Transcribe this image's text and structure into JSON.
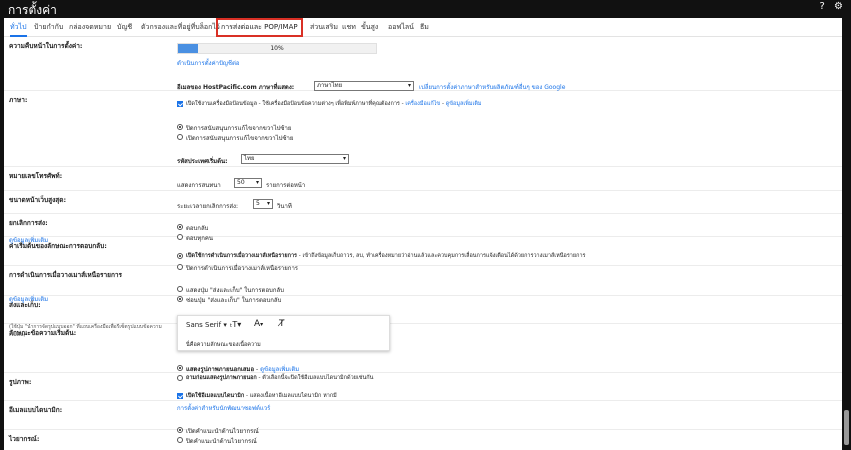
{
  "app": {
    "title": "การตั้งค่า",
    "help_icon": "help-icon",
    "settings_icon": "gear-icon"
  },
  "tabs": [
    {
      "label": "ทั่วไป",
      "active": true
    },
    {
      "label": "ป้ายกำกับ"
    },
    {
      "label": "กล่องจดหมาย"
    },
    {
      "label": "บัญชี"
    },
    {
      "label": "ตัวกรองและที่อยู่ที่บล็อกไว้"
    },
    {
      "label": "การส่งต่อและ POP/IMAP",
      "highlighted": true
    },
    {
      "label": "ส่วนเสริม"
    },
    {
      "label": "แชท"
    },
    {
      "label": "ขั้นสูง"
    },
    {
      "label": "ออฟไลน์"
    },
    {
      "label": "ธีม"
    }
  ],
  "progress": {
    "label": "ความคืบหน้าในการตั้งค่า:",
    "value_percent": 10,
    "value_text": "10%",
    "link": "ดำเนินการตั้งค่าปัญชีต่อ"
  },
  "language": {
    "label": "ภาษา:",
    "prefix": "อีเมลของ HostPacific.com ภาษาที่แสดง:",
    "selected": "ภาษาไทย",
    "change_link": "เปลี่ยนการตั้งค่าภาษาสำหรับผลิตภัณฑ์อื่นๆ ของ Google",
    "input_tools_text": "เปิดใช้งานเครื่องมือป้อนข้อมูล - ใช้เครื่องมือป้อนข้อความต่างๆ เพื่อพิมพ์ภาษาที่คุณต้องการ -",
    "input_tools_link": "เครื่องมือแก้ไข",
    "more_info": "ดูข้อมูลเพิ่มเติม",
    "rtl_off": "ปิดการสนับสนุนการแก้ไขจากขวาไปซ้าย",
    "rtl_on": "เปิดการสนับสนุนการแก้ไขจากขวาไปซ้าย"
  },
  "phone": {
    "label": "หมายเลขโทรศัพท์:",
    "prefix": "รหัสประเทศเริ่มต้น:",
    "selected": "ไทย"
  },
  "page_size": {
    "label": "ขนาดหน้าเว็บสูงสุด:",
    "prefix": "แสดงการสนทนา",
    "selected": "50",
    "suffix": "รายการต่อหน้า"
  },
  "undo_send": {
    "label": "ยกเลิกการส่ง:",
    "prefix": "ระยะเวลายกเลิกการส่ง:",
    "selected": "5",
    "suffix": "วินาที"
  },
  "reply": {
    "label": "ค่าเริ่มต้นของลักษณะการตอบกลับ:",
    "link": "ดูข้อมูลเพิ่มเติม",
    "opt1": "ตอบกลับ",
    "opt2": "ตอบทุกคน"
  },
  "hover": {
    "label": "การดำเนินการเมื่อวางเมาส์เหนือรายการ",
    "on_bold": "เปิดใช้การดำเนินการเมื่อวางเมาส์เหนือรายการ",
    "on_rest": " - เข้าถึงข้อมูลเก็บถาวร, ลบ, ทำเครื่องหมายว่าอ่านแล้วและควบคุมการเลื่อนการแจ้งเตือนได้ด้วยการวางเมาส์เหนือรายการ",
    "off": "ปิดการดำเนินการเมื่อวางเมาส์เหนือรายการ"
  },
  "send_archive": {
    "label": "ส่งและเก็บ:",
    "link": "ดูข้อมูลเพิ่มเติม",
    "show": "แสดงปุ่ม \"ส่งและเก็บ\" ในการตอบกลับ",
    "hide": "ซ่อนปุ่ม \"ส่งและเก็บ\" ในการตอบกลับ"
  },
  "default_text": {
    "label": "ลักษณะข้อความเริ่มต้น:",
    "note": "(ใช้ปุ่ม \"นำการจัดรูปแบบออก\" ที่แถบเครื่องมือเพื่อรีเซ็ตรูปแบบข้อความเริ่มต้น)",
    "font": "Sans Serif",
    "preview": "นี่คือความลักษณะของเนื้อความ"
  },
  "images": {
    "label": "รูปภาพ:",
    "show_bold": "แสดงรูปภาพภายนอกเสมอ",
    "show_link": "ดูข้อมูลเพิ่มเติม",
    "ask_bold": "ถามก่อนแสดงรูปภาพภายนอก",
    "ask_rest": " - ตัวเลือกนี้จะปิดใช้อีเมลแบบไดนามิกด้วยเช่นกัน"
  },
  "dynamic": {
    "label": "อีเมลแบบไดนามิก:",
    "text_bold": "เปิดใช้อีเมลแบบไดนามิก",
    "text_rest": " - แสดงเนื้อหาอีเมลแบบไดนามิก หากมี",
    "link": "การตั้งค่าสำหรับนักพัฒนาซอฟต์แวร์"
  },
  "grammar": {
    "label": "ไวยากรณ์:",
    "on": "เปิดคำแนะนำด้านไวยากรณ์",
    "off": "ปิดคำแนะนำด้านไวยากรณ์"
  }
}
